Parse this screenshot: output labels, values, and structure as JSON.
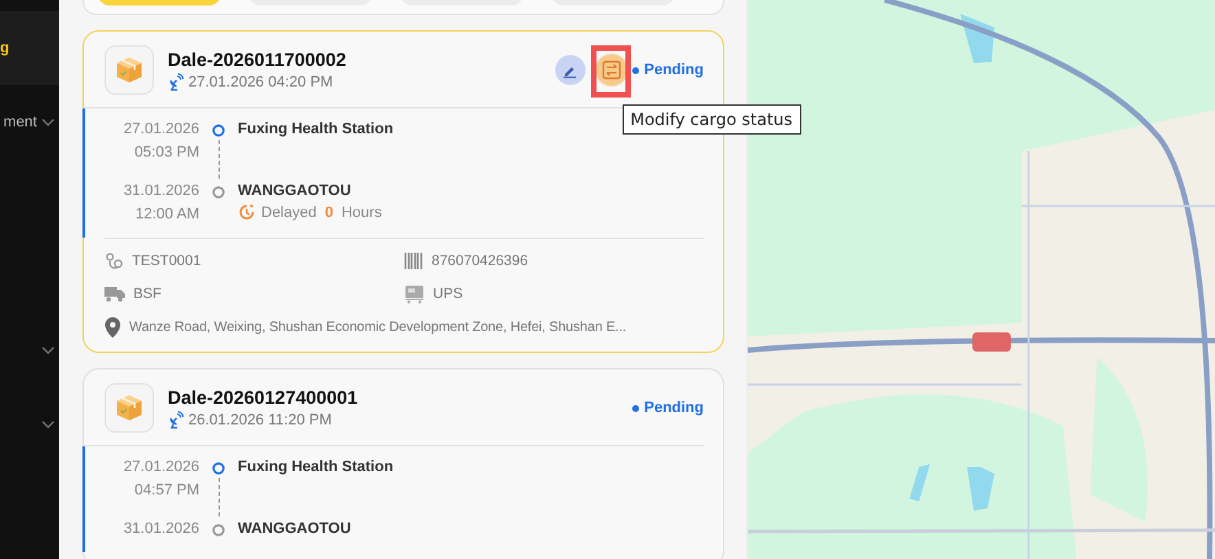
{
  "sidebar": {
    "items": [
      {
        "label": "g",
        "selected": true,
        "expandable": false
      },
      {
        "label": "ment",
        "selected": false,
        "expandable": true
      },
      {
        "selected": false,
        "expandable": true
      },
      {
        "selected": false,
        "expandable": true
      }
    ]
  },
  "tabs": [
    {
      "selected": true
    },
    {
      "selected": false
    },
    {
      "selected": false
    },
    {
      "selected": false
    }
  ],
  "cards": [
    {
      "title": "Dale-2026011700002",
      "time": "27.01.2026 04:20 PM",
      "status": "Pending",
      "selected": true,
      "actions": [
        {
          "kind": "edit",
          "highlighted": false
        },
        {
          "kind": "status",
          "highlighted": true
        }
      ],
      "stops": [
        {
          "kind": "origin",
          "date": "27.01.2026",
          "time": "05:03 PM",
          "place": "Fuxing Health Station"
        },
        {
          "kind": "destination",
          "date": "31.01.2026",
          "time": "12:00 AM",
          "place": "WANGGAOTOU"
        }
      ],
      "delay": {
        "label": "Delayed",
        "value": "0",
        "unit": "Hours"
      },
      "details": [
        {
          "kind": "route",
          "text": "TEST0001"
        },
        {
          "kind": "barcode",
          "text": "876070426396"
        },
        {
          "kind": "truck",
          "text": "BSF"
        },
        {
          "kind": "carrier",
          "text": "UPS"
        },
        {
          "kind": "location",
          "text": "Wanze Road, Weixing, Shushan Economic Development Zone, Hefei, Shushan E..."
        }
      ]
    },
    {
      "title": "Dale-20260127400001",
      "time": "26.01.2026 11:20 PM",
      "status": "Pending",
      "selected": false,
      "stops": [
        {
          "kind": "origin",
          "date": "27.01.2026",
          "time": "04:57 PM",
          "place": "Fuxing Health Station"
        },
        {
          "kind": "destination",
          "date": "31.01.2026",
          "place": "WANGGAOTOU"
        }
      ]
    }
  ],
  "tooltip": {
    "text": "Modify cargo status"
  }
}
